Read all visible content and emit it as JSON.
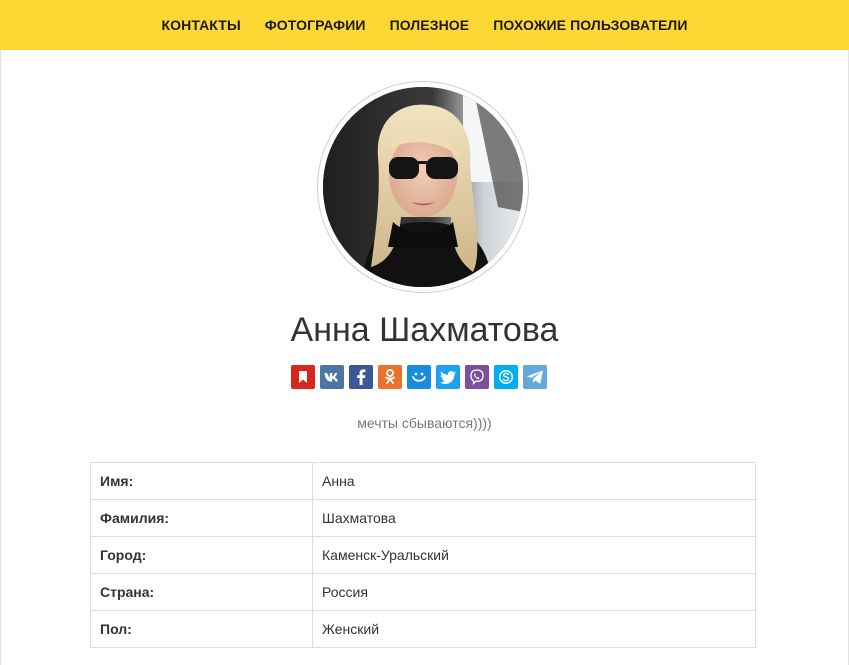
{
  "nav": {
    "items": [
      {
        "label": "КОНТАКТЫ"
      },
      {
        "label": "ФОТОГРАФИИ"
      },
      {
        "label": "ПОЛЕЗНОЕ"
      },
      {
        "label": "ПОХОЖИЕ ПОЛЬЗОВАТЕЛИ"
      }
    ],
    "background": "#fdd835"
  },
  "profile": {
    "name": "Анна Шахматова",
    "status": "мечты сбываются))))"
  },
  "share": [
    {
      "icon": "bookmark-icon",
      "color": "#d9261c"
    },
    {
      "icon": "vk-icon",
      "color": "#4c75a3"
    },
    {
      "icon": "facebook-icon",
      "color": "#3b5998"
    },
    {
      "icon": "odnoklassniki-icon",
      "color": "#eb722e"
    },
    {
      "icon": "moimir-icon",
      "color": "#168de2"
    },
    {
      "icon": "twitter-icon",
      "color": "#1da1f2"
    },
    {
      "icon": "viber-icon",
      "color": "#7b519d"
    },
    {
      "icon": "skype-icon",
      "color": "#00aff0"
    },
    {
      "icon": "telegram-icon",
      "color": "#64a9dc"
    }
  ],
  "info": {
    "rows": [
      {
        "label": "Имя:",
        "value": "Анна"
      },
      {
        "label": "Фамилия:",
        "value": "Шахматова"
      },
      {
        "label": "Город:",
        "value": "Каменск-Уральский"
      },
      {
        "label": "Страна:",
        "value": "Россия"
      },
      {
        "label": "Пол:",
        "value": "Женский"
      }
    ]
  }
}
